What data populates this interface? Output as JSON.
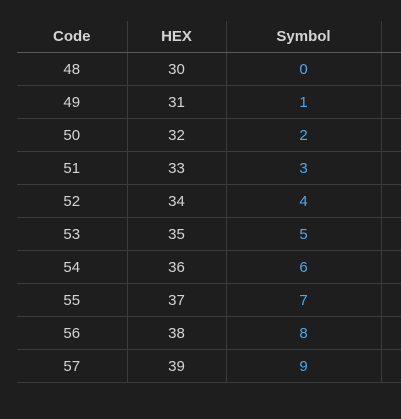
{
  "table": {
    "headers": [
      "Code",
      "HEX",
      "Symbol"
    ],
    "rows": [
      {
        "code": "48",
        "hex": "30",
        "symbol": "0"
      },
      {
        "code": "49",
        "hex": "31",
        "symbol": "1"
      },
      {
        "code": "50",
        "hex": "32",
        "symbol": "2"
      },
      {
        "code": "51",
        "hex": "33",
        "symbol": "3"
      },
      {
        "code": "52",
        "hex": "34",
        "symbol": "4"
      },
      {
        "code": "53",
        "hex": "35",
        "symbol": "5"
      },
      {
        "code": "54",
        "hex": "36",
        "symbol": "6"
      },
      {
        "code": "55",
        "hex": "37",
        "symbol": "7"
      },
      {
        "code": "56",
        "hex": "38",
        "symbol": "8"
      },
      {
        "code": "57",
        "hex": "39",
        "symbol": "9"
      }
    ]
  },
  "colors": {
    "background": "#1e1e1e",
    "text": "#d4d4d4",
    "symbol_text": "#4fa8e8",
    "grid_line": "#3c3c3c"
  }
}
